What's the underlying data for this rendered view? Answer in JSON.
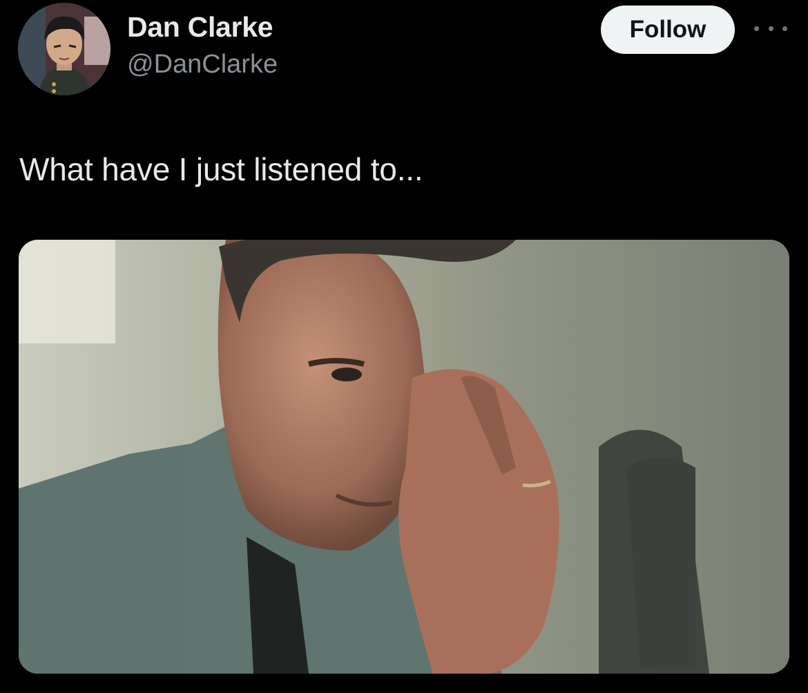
{
  "author": {
    "display_name": "Dan Clarke",
    "handle": "@DanClarke",
    "avatar_icon": "cartoon-avatar"
  },
  "actions": {
    "follow_label": "Follow",
    "more_icon": "more-dots-icon"
  },
  "tweet": {
    "text": "What have I just listened to..."
  },
  "colors": {
    "background": "#000000",
    "primary_text": "#e7e9ea",
    "secondary_text": "#8b9096",
    "follow_button_bg": "#eff3f4",
    "follow_button_text": "#0f1419"
  }
}
